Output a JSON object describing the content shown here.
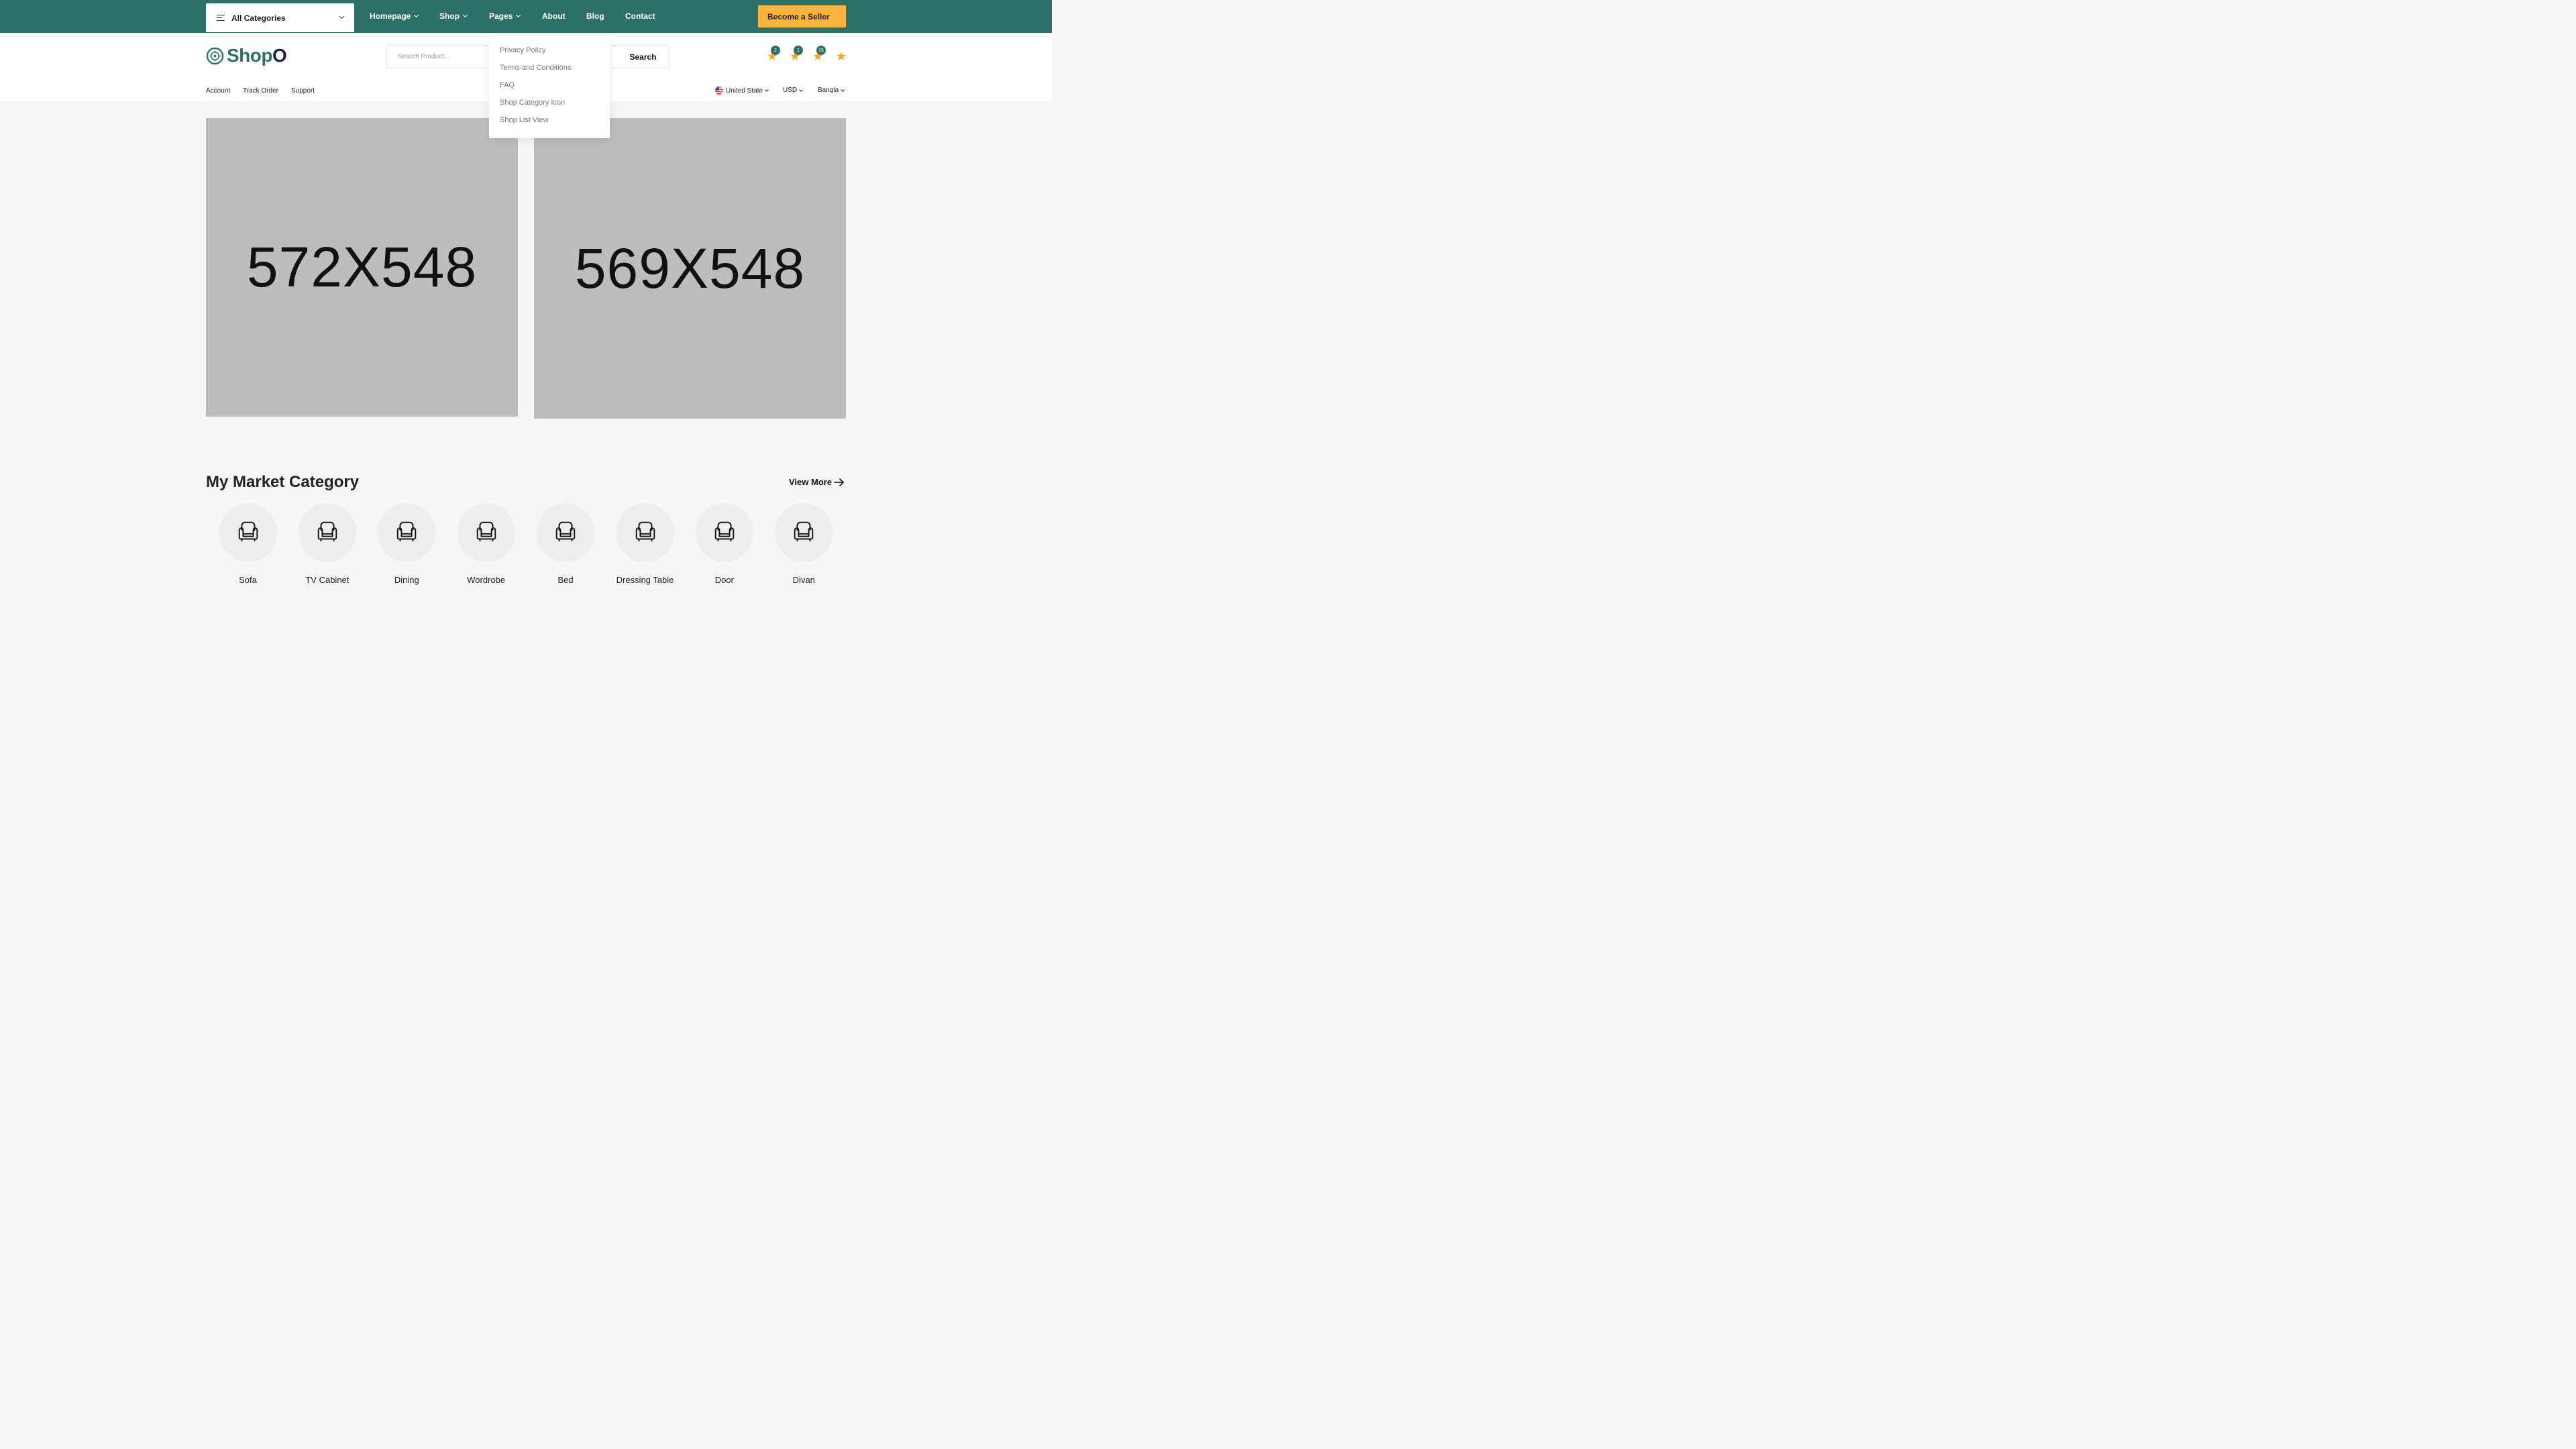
{
  "topbar": {
    "all_categories": "All Categories",
    "nav": [
      {
        "label": "Homepage",
        "has_dropdown": true
      },
      {
        "label": "Shop",
        "has_dropdown": true
      },
      {
        "label": "Pages",
        "has_dropdown": true
      },
      {
        "label": "About",
        "has_dropdown": false
      },
      {
        "label": "Blog",
        "has_dropdown": false
      },
      {
        "label": "Contact",
        "has_dropdown": false
      }
    ],
    "seller_button": "Become a Seller",
    "colors": {
      "bar": "#2d7068",
      "accent": "#fdb43c"
    }
  },
  "pages_dropdown": {
    "items": [
      "Privacy Policy",
      "Terms and Conditions",
      "FAQ",
      "Shop Category Icon",
      "Shop List View"
    ]
  },
  "header": {
    "logo": {
      "text_main": "Shop",
      "text_end": "O",
      "icon": "target-logo-icon"
    },
    "search": {
      "placeholder": "Search Product...",
      "button": "Search"
    },
    "icons": [
      {
        "icon": "star-icon",
        "badge": "2"
      },
      {
        "icon": "star-icon",
        "badge": "1"
      },
      {
        "icon": "star-icon",
        "badge": "15"
      },
      {
        "icon": "star-icon",
        "badge": null
      }
    ],
    "links": [
      "Account",
      "Track Order",
      "Support"
    ],
    "locale": {
      "country": "United State",
      "currency": "USD",
      "language": "Bangla"
    }
  },
  "banners": [
    {
      "label": "572X548"
    },
    {
      "label": "569X548"
    }
  ],
  "categories": {
    "title": "My Market Category",
    "view_more": "View More",
    "items": [
      {
        "name": "Sofa",
        "icon": "armchair-icon"
      },
      {
        "name": "TV Cabinet",
        "icon": "armchair-icon"
      },
      {
        "name": "Dining",
        "icon": "armchair-icon"
      },
      {
        "name": "Wordrobe",
        "icon": "armchair-icon"
      },
      {
        "name": "Bed",
        "icon": "armchair-icon"
      },
      {
        "name": "Dressing Table",
        "icon": "armchair-icon"
      },
      {
        "name": "Door",
        "icon": "armchair-icon"
      },
      {
        "name": "Divan",
        "icon": "armchair-icon"
      }
    ]
  }
}
